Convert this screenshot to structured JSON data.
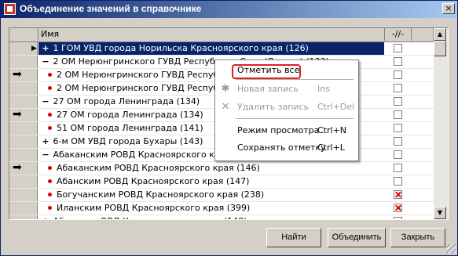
{
  "window": {
    "title": "Объединение значений в справочнике",
    "close_glyph": "×"
  },
  "grid": {
    "col_name": "Имя",
    "col_mark": "-//-",
    "rows": [
      {
        "arrow": "",
        "tri": "▶",
        "toggle": "+",
        "leaf": false,
        "label": "1 ГОМ УВД города Норильска Красноярского края (126)",
        "selected": true,
        "checked": false
      },
      {
        "arrow": "",
        "tri": "",
        "toggle": "−",
        "leaf": false,
        "label": "2 ОМ Нерюнгринского ГУВД Республики Саха (Якутия) (133)",
        "selected": false,
        "checked": false
      },
      {
        "arrow": "➡",
        "tri": "",
        "toggle": "",
        "leaf": true,
        "label": "2 ОМ Нерюнгринского ГУВД Республики Саха (Якутия) (133)",
        "selected": false,
        "checked": false
      },
      {
        "arrow": "",
        "tri": "",
        "toggle": "",
        "leaf": true,
        "label": "2 ОМ Нерюнгринского ГУВД Республики Саха (Якутия) (133)",
        "selected": false,
        "checked": false
      },
      {
        "arrow": "",
        "tri": "",
        "toggle": "−",
        "leaf": false,
        "label": "27 ОМ города Ленинграда (134)",
        "selected": false,
        "checked": false
      },
      {
        "arrow": "➡",
        "tri": "",
        "toggle": "",
        "leaf": true,
        "label": "27 ОМ города Ленинграда (134)",
        "selected": false,
        "checked": false
      },
      {
        "arrow": "",
        "tri": "",
        "toggle": "",
        "leaf": true,
        "label": "51 ОМ города Ленинграда (141)",
        "selected": false,
        "checked": false
      },
      {
        "arrow": "",
        "tri": "",
        "toggle": "+",
        "leaf": false,
        "label": "6-м ОМ УВД города Бухары (143)",
        "selected": false,
        "checked": false
      },
      {
        "arrow": "",
        "tri": "",
        "toggle": "−",
        "leaf": false,
        "label": "Абаканским РОВД Красноярского края (146)",
        "selected": false,
        "checked": false
      },
      {
        "arrow": "➡",
        "tri": "",
        "toggle": "",
        "leaf": true,
        "label": "Абаканским РОВД Красноярского края (146)",
        "selected": false,
        "checked": false
      },
      {
        "arrow": "",
        "tri": "",
        "toggle": "",
        "leaf": true,
        "label": "Абанским РОВД Красноярского края (147)",
        "selected": false,
        "checked": false
      },
      {
        "arrow": "",
        "tri": "",
        "toggle": "",
        "leaf": true,
        "label": "Богучанским РОВД Красноярского края (238)",
        "selected": false,
        "checked": true
      },
      {
        "arrow": "",
        "tri": "",
        "toggle": "",
        "leaf": true,
        "label": "Иланским РОВД Красноярского края (399)",
        "selected": false,
        "checked": true
      },
      {
        "arrow": "",
        "tri": "",
        "toggle": "+",
        "leaf": false,
        "label": "Абинским ОВД Краснодарского края (148)",
        "selected": false,
        "checked": false
      }
    ]
  },
  "context_menu": {
    "items": [
      {
        "label": "Отметить все",
        "shortcut": "",
        "disabled": false,
        "icon": "",
        "highlighted": true
      },
      {
        "label": "Новая запись",
        "shortcut": "Ins",
        "disabled": true,
        "icon": "new-record-icon",
        "highlighted": false
      },
      {
        "label": "Удалить запись",
        "shortcut": "Ctrl+Del",
        "disabled": true,
        "icon": "delete-icon",
        "highlighted": false
      },
      {
        "label": "Режим просмотра",
        "shortcut": "Ctrl+N",
        "disabled": false,
        "icon": "",
        "highlighted": false
      },
      {
        "label": "Сохранять отметку",
        "shortcut": "Ctrl+L",
        "disabled": false,
        "icon": "",
        "highlighted": false
      }
    ]
  },
  "buttons": {
    "find": "Найти",
    "merge": "Объединить",
    "close": "Закрыть"
  },
  "colors": {
    "titlebar": "#0a246a",
    "selection": "#0a246a",
    "highlight_box": "#e02020",
    "check_mark": "#e00000"
  }
}
